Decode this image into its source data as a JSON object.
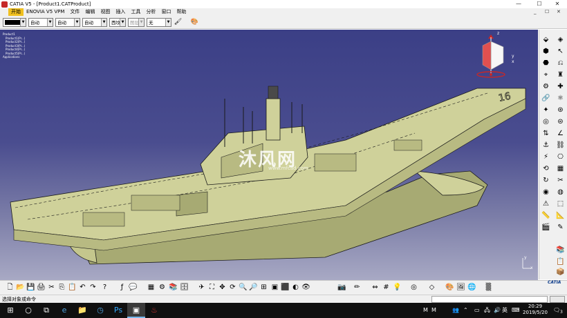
{
  "window": {
    "title": "CATIA V5 - [Product1.CATProduct]",
    "minimize_glyph": "—",
    "maximize_glyph": "☐",
    "close_glyph": "✕"
  },
  "menu": {
    "items": [
      "开始",
      "ENOVIA V5 VPM",
      "文件",
      "编辑",
      "视图",
      "插入",
      "工具",
      "分析",
      "窗口",
      "帮助"
    ],
    "mdi_controls": [
      "_",
      "☐",
      "✕"
    ]
  },
  "properties_toolbar": {
    "color_value": "#000000",
    "transparency": "自动",
    "line_thickness": "自动",
    "line_type": "自动",
    "point_type": "西坟",
    "layer": "图层",
    "render_style": "无"
  },
  "spec_tree": {
    "root": "Product1",
    "items": [
      "Product1(Pr...)",
      "Product2(Pr...)",
      "Product3(Pr...)",
      "Product4(Pr...)",
      "Product5(Pr...)"
    ],
    "footer": "Applications"
  },
  "compass": {
    "z_label": "z",
    "y_label": "y",
    "x_label": "x"
  },
  "axis_triad": {
    "y_label": "y",
    "x_label": "x"
  },
  "ship": {
    "hull_number": "16"
  },
  "watermark": {
    "title": "沐风网",
    "url": "www.mfcad.com"
  },
  "status": {
    "text": "选择对象或命令",
    "command_value": ""
  },
  "logo": {
    "text": "CATIA"
  },
  "taskbar": {
    "time": "20:29",
    "date": "2019/5/20",
    "ime_label": "英",
    "notification_count": "3",
    "tray_letters": [
      "M",
      "M"
    ]
  },
  "colors": {
    "hull": "#cfd19a",
    "hull_shadow": "#a7aa73",
    "outline": "#1a1a1a",
    "viewport_top": "#3b3f86",
    "viewport_bottom": "#a8a9c4",
    "menu_active": "#f0c020"
  }
}
